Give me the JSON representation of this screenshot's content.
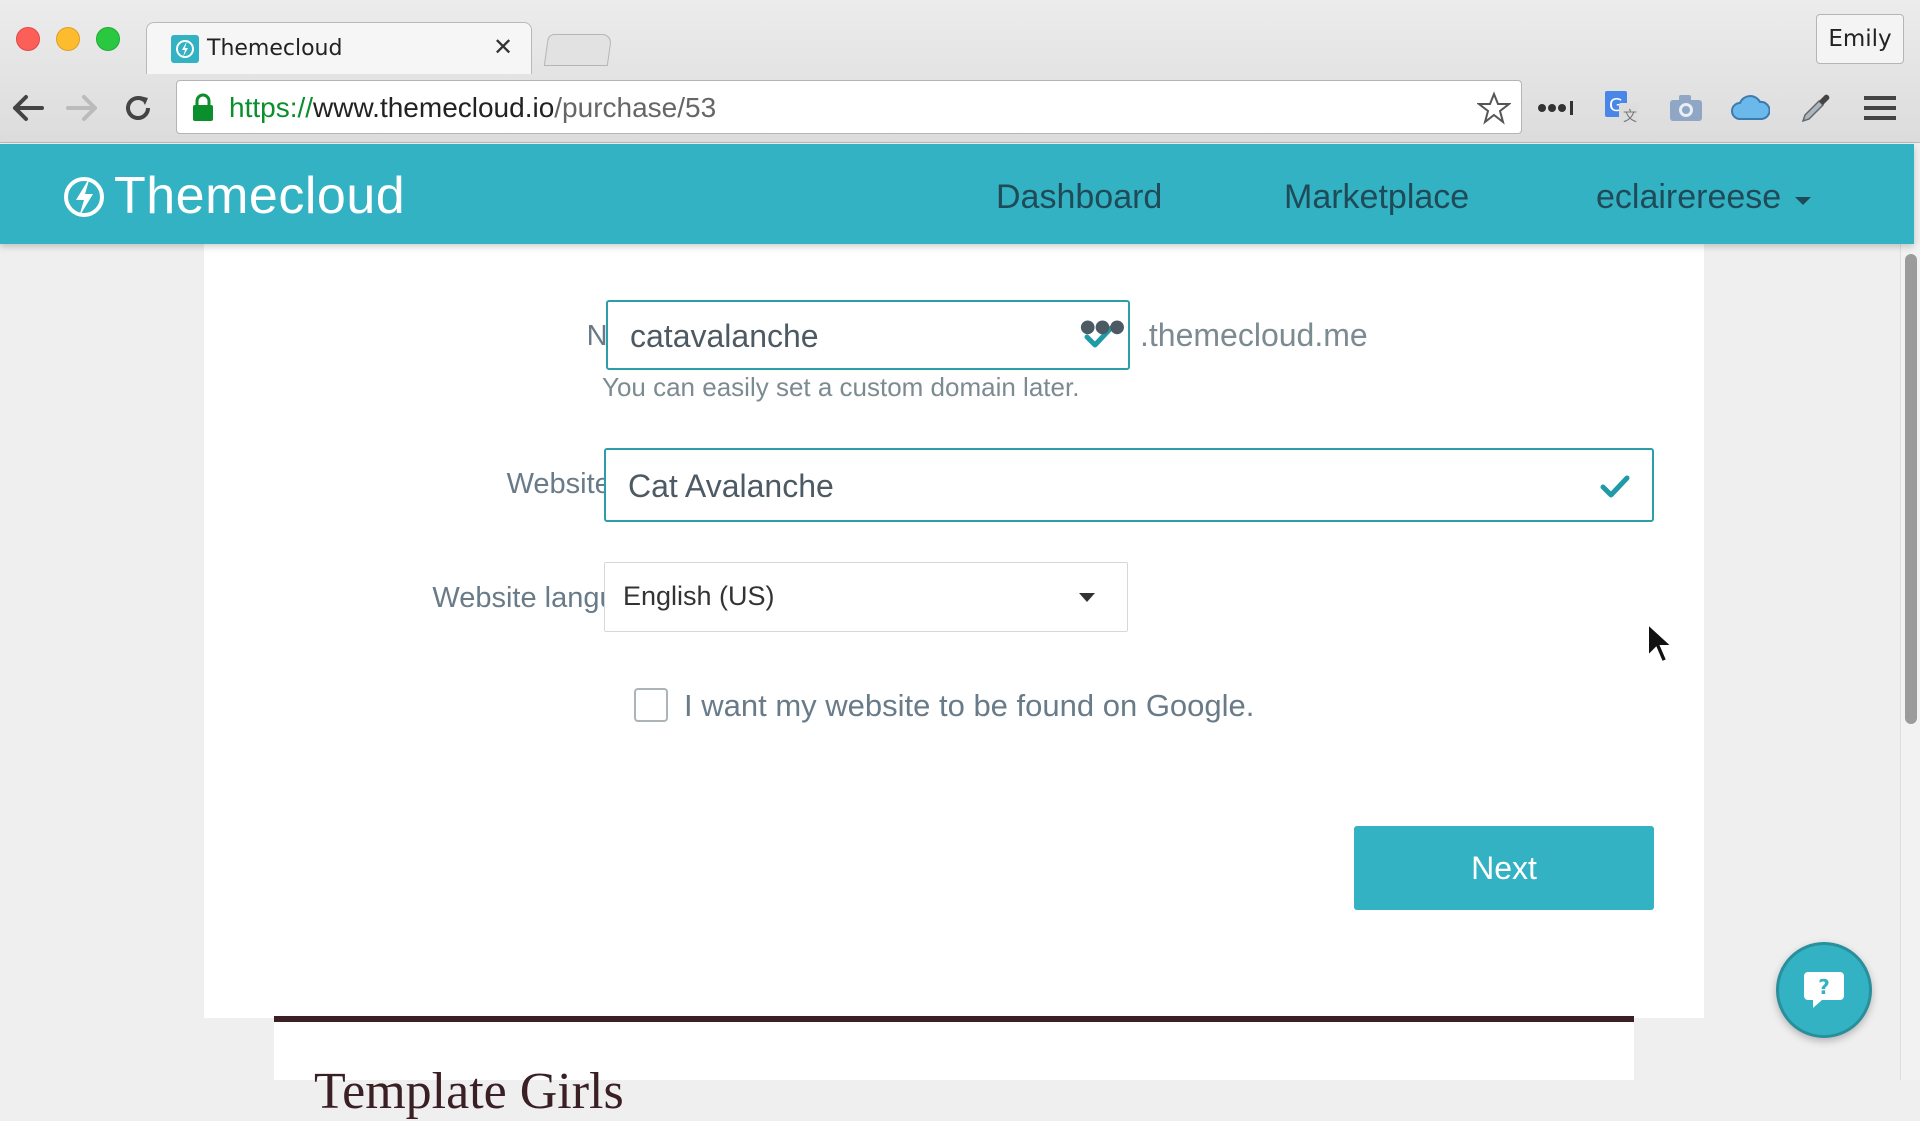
{
  "browser": {
    "tab_title": "Themecloud",
    "profile_name": "Emily",
    "url": {
      "scheme": "https://",
      "host": "www.themecloud.io",
      "path": "/purchase/53"
    }
  },
  "app": {
    "brand": "Themecloud",
    "brand_color": "#33b2c3",
    "nav": {
      "dashboard": "Dashboard",
      "marketplace": "Marketplace",
      "user": "eclairereese"
    }
  },
  "form": {
    "name": {
      "label": "Name",
      "value": "catavalanche",
      "suffix": ".themecloud.me",
      "hint": "You can easily set a custom domain later."
    },
    "website_title": {
      "label": "Website title",
      "value": "Cat Avalanche"
    },
    "website_language": {
      "label": "Website language",
      "selected": "English (US)"
    },
    "google_checkbox": {
      "label": "I want my website to be found on Google.",
      "checked": false
    },
    "next_button": "Next"
  },
  "section_below": {
    "title": "Template Girls"
  }
}
